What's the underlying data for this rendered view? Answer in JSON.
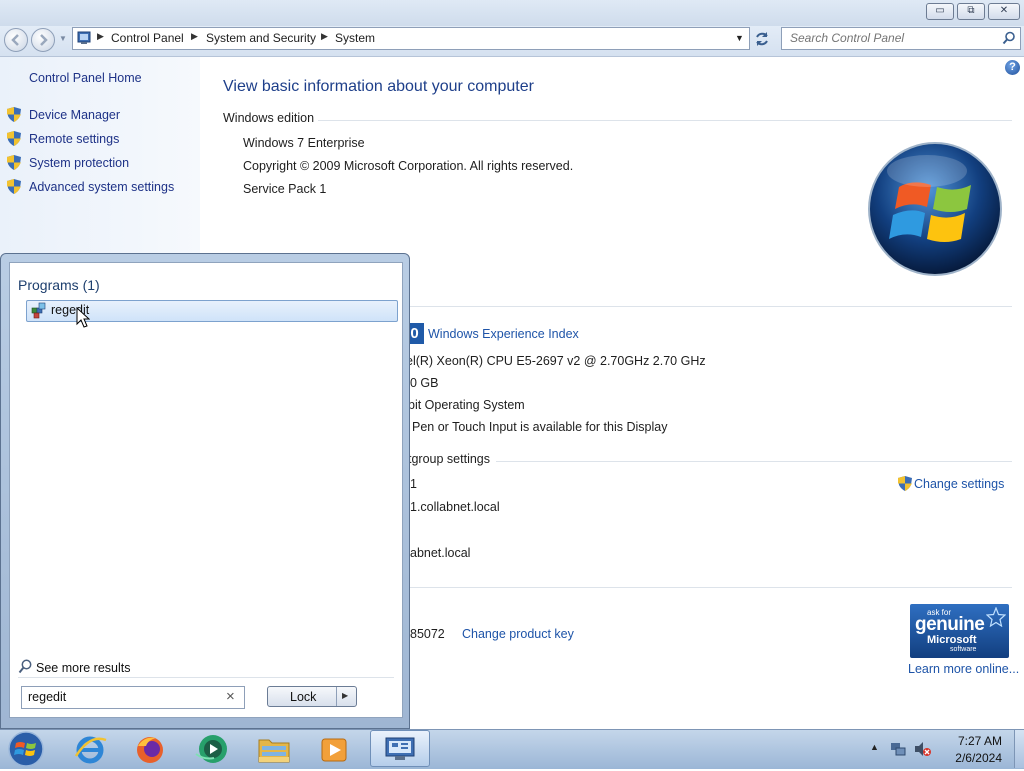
{
  "window": {
    "minimize_label": "▭",
    "maximize_label": "⧉",
    "close_label": "✕"
  },
  "address": {
    "crumbs": [
      "Control Panel",
      "System and Security",
      "System"
    ],
    "search_placeholder": "Search Control Panel"
  },
  "sidebar": {
    "home": "Control Panel Home",
    "links": [
      "Device Manager",
      "Remote settings",
      "System protection",
      "Advanced system settings"
    ]
  },
  "main": {
    "title": "View basic information about your computer",
    "edition_heading": "Windows edition",
    "edition": "Windows 7 Enterprise",
    "copyright": "Copyright © 2009 Microsoft Corporation.  All rights reserved.",
    "service_pack": "Service Pack 1",
    "wei_digit": "0",
    "wei_link": "Windows Experience Index",
    "processor": "el(R) Xeon(R) CPU E5-2697 v2 @ 2.70GHz   2.70 GHz",
    "memory": "0 GB",
    "system_type": "bit Operating System",
    "pen_touch": "Pen or Touch Input is available for this Display",
    "workgroup_heading": "tgroup settings",
    "computer_name": "1",
    "full_name": "1.collabnet.local",
    "domain": "abnet.local",
    "change_settings": "Change settings",
    "product_id": "85072",
    "change_key": "Change product key",
    "genuine_small": "ask for",
    "genuine_big": "genuine",
    "genuine_ms": "Microsoft",
    "genuine_sw": "software",
    "learn_more": "Learn more online..."
  },
  "startmenu": {
    "programs_heading": "Programs (1)",
    "result": "regedit",
    "see_more": "See more results",
    "search_value": "regedit",
    "clear_label": "×",
    "lock_label": "Lock",
    "lock_arrow": "▶"
  },
  "taskbar": {
    "time": "7:27 AM",
    "date": "2/6/2024",
    "tray_up": "▲"
  },
  "help_label": "?"
}
